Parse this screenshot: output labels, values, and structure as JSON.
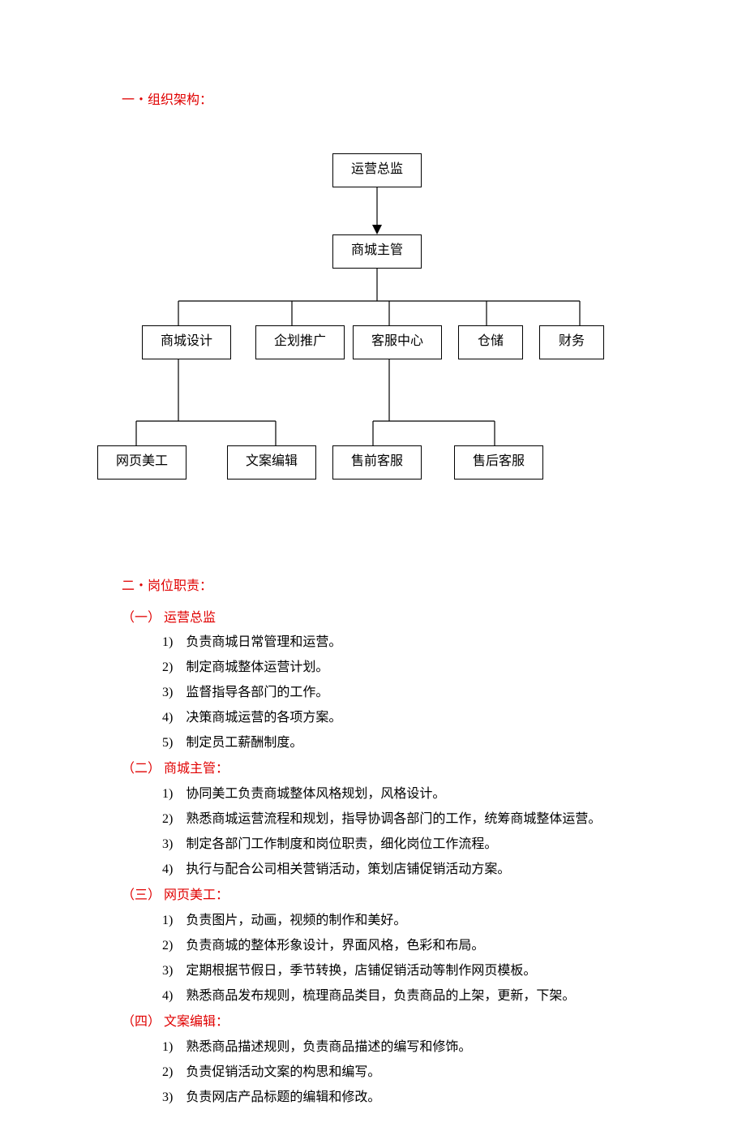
{
  "section1": {
    "title": "一・组织架构：",
    "nodes": {
      "top": "运营总监",
      "mid": "商城主管",
      "row2": [
        "商城设计",
        "企划推广",
        "客服中心",
        "仓储",
        "财务"
      ],
      "row3_left": [
        "网页美工",
        "文案编辑"
      ],
      "row3_right": [
        "售前客服",
        "售后客服"
      ]
    }
  },
  "section2": {
    "title": "二・岗位职责：",
    "roles": [
      {
        "head": "（一） 运营总监",
        "items": [
          "1)　负责商城日常管理和运营。",
          "2)　制定商城整体运营计划。",
          "3)　监督指导各部门的工作。",
          "4)　决策商城运营的各项方案。",
          "5)　制定员工薪酬制度。"
        ]
      },
      {
        "head": "（二） 商城主管：",
        "items": [
          "1)　协同美工负责商城整体风格规划，风格设计。",
          "2)　熟悉商城运营流程和规划，指导协调各部门的工作，统筹商城整体运营。",
          "3)　制定各部门工作制度和岗位职责，细化岗位工作流程。",
          "4)　执行与配合公司相关营销活动，策划店铺促销活动方案。"
        ]
      },
      {
        "head": "（三） 网页美工：",
        "items": [
          "1)　负责图片，动画，视频的制作和美好。",
          "2)　负责商城的整体形象设计，界面风格，色彩和布局。",
          "3)　定期根据节假日，季节转换，店铺促销活动等制作网页模板。",
          "4)　熟悉商品发布规则，梳理商品类目，负责商品的上架，更新，下架。"
        ]
      },
      {
        "head": "（四） 文案编辑：",
        "items": [
          "1)　熟悉商品描述规则，负责商品描述的编写和修饰。",
          "2)　负责促销活动文案的构思和编写。",
          "3)　负责网店产品标题的编辑和修改。"
        ]
      }
    ]
  },
  "chart_data": {
    "type": "diagram-orgchart",
    "title": "组织架构",
    "hierarchy": {
      "name": "运营总监",
      "children": [
        {
          "name": "商城主管",
          "children": [
            {
              "name": "商城设计",
              "children": [
                {
                  "name": "网页美工"
                },
                {
                  "name": "文案编辑"
                }
              ]
            },
            {
              "name": "企划推广"
            },
            {
              "name": "客服中心",
              "children": [
                {
                  "name": "售前客服"
                },
                {
                  "name": "售后客服"
                }
              ]
            },
            {
              "name": "仓储"
            },
            {
              "name": "财务"
            }
          ]
        }
      ]
    }
  }
}
